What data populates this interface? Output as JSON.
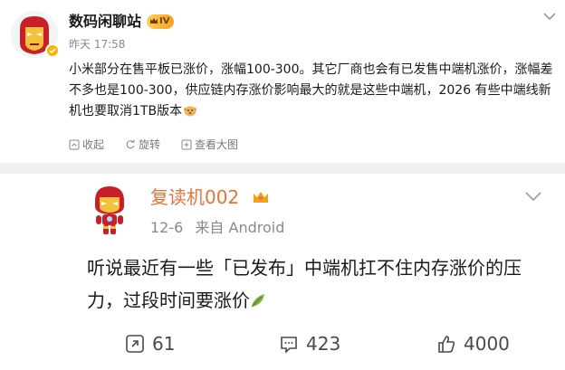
{
  "post": {
    "username": "数码闲聊站",
    "vip_level": "IV",
    "timestamp": "昨天 17:58",
    "text": "小米部分在售平板已涨价，涨幅100-300。其它厂商也会有已发售中端机涨价，涨幅差不多也是100-300，供应链内存涨价影响最大的就是这些中端机，2026 有些中端线新机也要取消1TB版本",
    "actions": {
      "favorite_label": "收起",
      "repost_label": "旋转",
      "bigpic_label": "查看大图"
    }
  },
  "quoted": {
    "username": "复读机002",
    "date": "12-6",
    "source": "来自 Android",
    "text": "听说最近有一些「已发布」中端机扛不住内存涨价的压力，过段时间要涨价",
    "reposts": "61",
    "comments": "423",
    "likes": "4000"
  },
  "icons": {
    "post_avatar": "iron-man-avatar-icon",
    "verified_badge": "verified-badge-icon",
    "vip_crown": "crown-icon",
    "more": "chevron-down-icon",
    "doge_emoji": "dog-emoji-icon",
    "collapse": "collapse-icon",
    "rotate": "rotate-icon",
    "view_big": "view-big-image-icon",
    "quoted_avatar": "iron-man-chibi-avatar-icon",
    "leaf_emoji": "leaf-emoji-icon",
    "repost": "repost-icon",
    "comment": "comment-icon",
    "like": "thumbs-up-icon"
  },
  "colors": {
    "accent_orange": "#e8733a",
    "vip_gold": "#f4a11a",
    "text_primary": "#1a1a1a",
    "text_secondary": "#8a8a8a"
  }
}
